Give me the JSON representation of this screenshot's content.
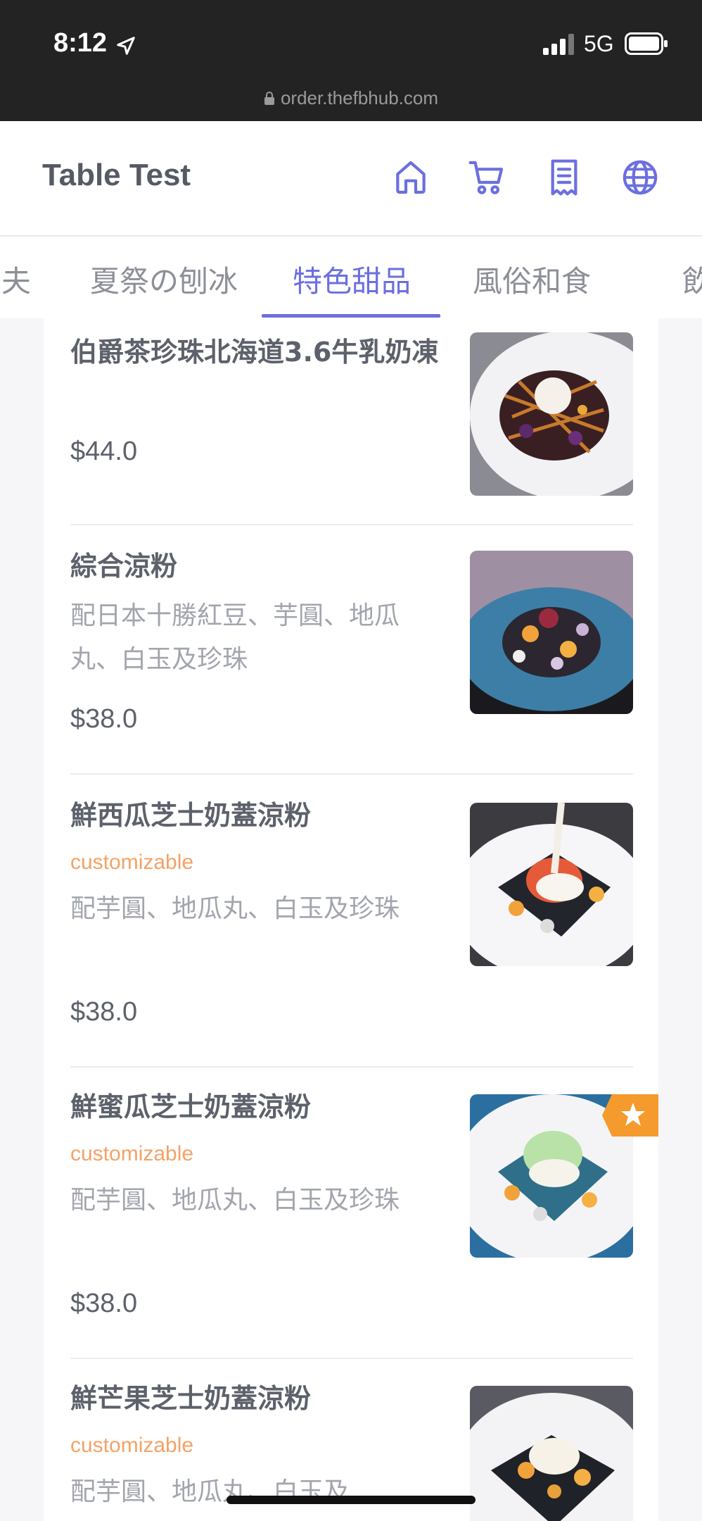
{
  "status_bar": {
    "time": "8:12",
    "network": "5G",
    "url": "order.thefbhub.com"
  },
  "header": {
    "title": "Table Test",
    "icons": [
      "home-icon",
      "cart-icon",
      "receipt-icon",
      "globe-icon"
    ],
    "accent_color": "#6b6fe0"
  },
  "tabs": [
    {
      "label": "夫",
      "active": false
    },
    {
      "label": "夏祭の刨冰",
      "active": false
    },
    {
      "label": "特色甜品",
      "active": true
    },
    {
      "label": "風俗和食",
      "active": false
    },
    {
      "label": "飲",
      "active": false
    }
  ],
  "menu_items": [
    {
      "name": "伯爵茶珍珠北海道3.6牛乳奶凍",
      "tag": "",
      "description": "",
      "price": "$44.0"
    },
    {
      "name": "綜合涼粉",
      "tag": "",
      "description": "配日本十勝紅豆、芋圓、地瓜丸、白玉及珍珠",
      "price": "$38.0"
    },
    {
      "name": "鮮西瓜芝士奶蓋涼粉",
      "tag": "customizable",
      "description": "配芋圓、地瓜丸、白玉及珍珠",
      "price": "$38.0"
    },
    {
      "name": "鮮蜜瓜芝士奶蓋涼粉",
      "tag": "customizable",
      "description": "配芋圓、地瓜丸、白玉及珍珠",
      "price": "$38.0"
    },
    {
      "name": "鮮芒果芝士奶蓋涼粉",
      "tag": "customizable",
      "description": "配芋圓、地瓜丸、白玉及",
      "price": ""
    }
  ]
}
